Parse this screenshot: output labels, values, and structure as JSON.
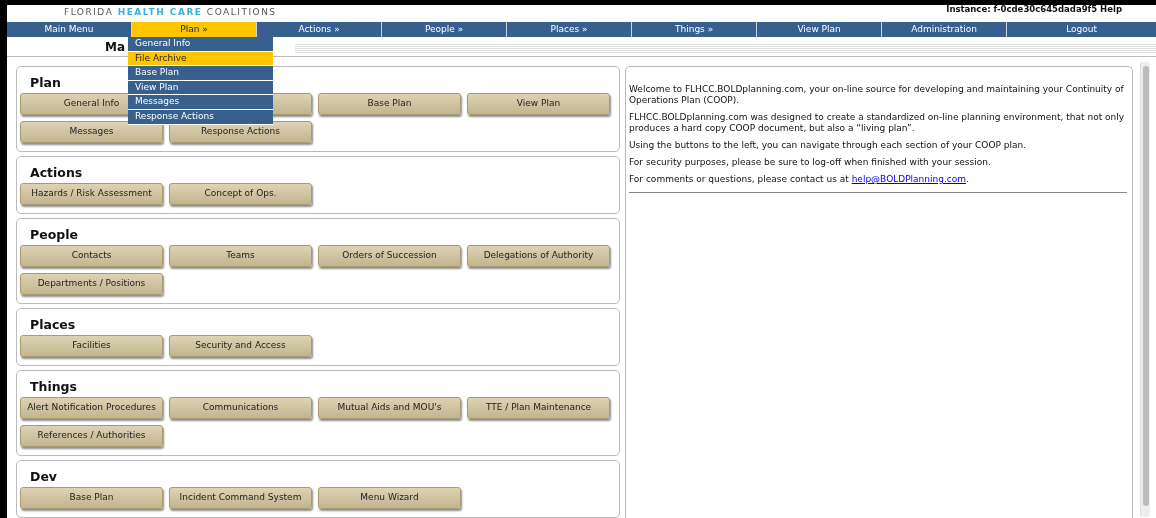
{
  "header": {
    "logo": {
      "before": "FLORIDA",
      "highlight": "HEALTH CARE",
      "after": "COALITIONS"
    },
    "instance": "Instance: f-0cde30c645dada9f5 Help"
  },
  "nav": [
    {
      "label": "Main Menu",
      "selected": false
    },
    {
      "label": "Plan »",
      "selected": true
    },
    {
      "label": "Actions »",
      "selected": false
    },
    {
      "label": "People »",
      "selected": false
    },
    {
      "label": "Places »",
      "selected": false
    },
    {
      "label": "Things »",
      "selected": false
    },
    {
      "label": "View Plan",
      "selected": false
    },
    {
      "label": "Administration",
      "selected": false
    },
    {
      "label": "Logout",
      "selected": false
    }
  ],
  "dropdown": [
    {
      "label": "General Info",
      "selected": false
    },
    {
      "label": "File Archive",
      "selected": true
    },
    {
      "label": "Base Plan",
      "selected": false
    },
    {
      "label": "View Plan",
      "selected": false
    },
    {
      "label": "Messages",
      "selected": false
    },
    {
      "label": "Response Actions",
      "selected": false
    }
  ],
  "page_title": "Ma",
  "sections": [
    {
      "title": "Plan",
      "buttons": [
        {
          "label": "General Info"
        },
        {
          "covered": true
        },
        {
          "label": "Base Plan"
        },
        {
          "label": "View Plan"
        },
        {
          "label": "Messages"
        },
        {
          "label": "Response Actions"
        }
      ]
    },
    {
      "title": "Actions",
      "buttons": [
        {
          "label": "Hazards / Risk Assessment"
        },
        {
          "label": "Concept of Ops."
        }
      ]
    },
    {
      "title": "People",
      "buttons": [
        {
          "label": "Contacts"
        },
        {
          "label": "Teams"
        },
        {
          "label": "Orders of Succession"
        },
        {
          "label": "Delegations of Authority"
        },
        {
          "label": "Departments / Positions"
        }
      ]
    },
    {
      "title": "Places",
      "buttons": [
        {
          "label": "Facilities"
        },
        {
          "label": "Security and Access"
        }
      ]
    },
    {
      "title": "Things",
      "buttons": [
        {
          "label": "Alert Notification Procedures"
        },
        {
          "label": "Communications"
        },
        {
          "label": "Mutual Aids and MOU's"
        },
        {
          "label": "TTE / Plan Maintenance"
        },
        {
          "label": "References / Authorities"
        }
      ]
    },
    {
      "title": "Dev",
      "buttons": [
        {
          "label": "Base Plan"
        },
        {
          "label": "Incident Command System"
        },
        {
          "label": "Menu Wizard"
        }
      ]
    }
  ],
  "welcome": {
    "paragraphs": [
      "Welcome to FLHCC.BOLDplanning.com, your on-line source for developing and maintaining your Continuity of Operations Plan (COOP).",
      "FLHCC.BOLDplanning.com was designed to create a standardized on-line planning environment, that not only produces a hard copy COOP document, but also a “living plan”.",
      "Using the buttons to the left, you can navigate through each section of your COOP plan.",
      "For security purposes, please be sure to log-off when finished with your session."
    ],
    "contact": {
      "before": "For comments or questions, please contact us at",
      "link": "help@BOLDPlanning.com",
      "after": "."
    }
  }
}
